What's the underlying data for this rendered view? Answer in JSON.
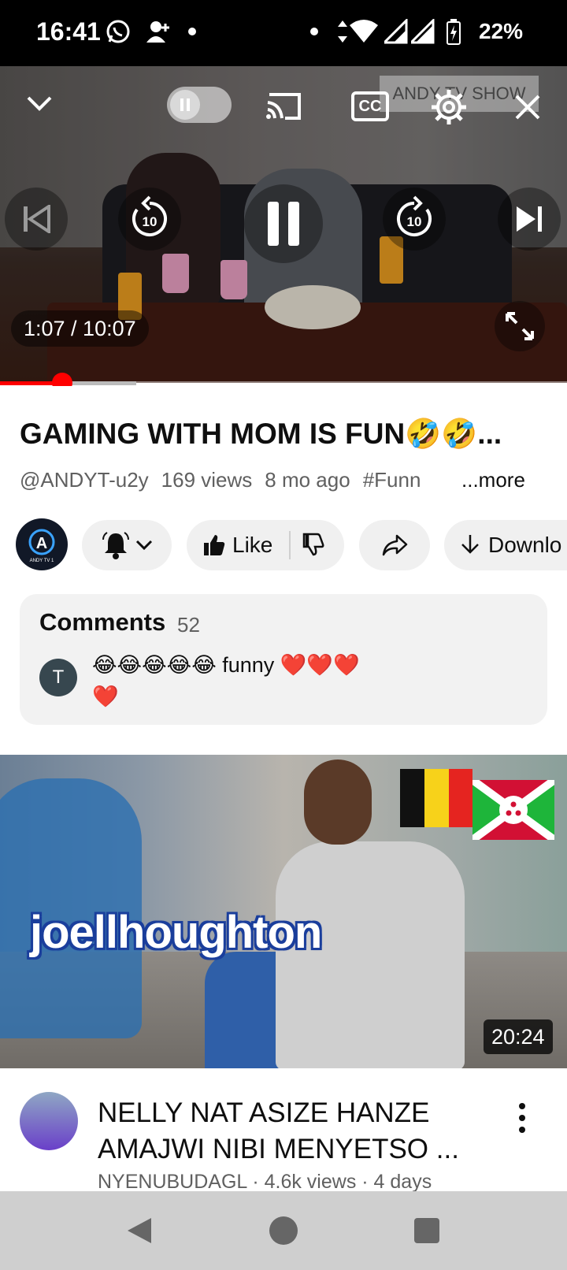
{
  "status_bar": {
    "time": "16:41",
    "battery": "22%",
    "icons": [
      "whatsapp-icon",
      "person-add-icon",
      "dot-icon",
      "dot-icon",
      "data-arrows-icon",
      "wifi-icon",
      "signal-icon",
      "signal-icon",
      "battery-charging-icon"
    ]
  },
  "player": {
    "watermark": "ANDY TV SHOW",
    "time_display": "1:07 / 10:07",
    "progress_played_pct": 11,
    "progress_buffered_pct": 24,
    "seek_back_seconds": "10",
    "seek_forward_seconds": "10",
    "cc_label": "CC",
    "icons": [
      "collapse-chevron-icon",
      "autoplay-toggle-icon",
      "cast-icon",
      "captions-icon",
      "settings-gear-icon",
      "close-icon",
      "previous-icon",
      "replay-10-icon",
      "pause-icon",
      "forward-10-icon",
      "next-icon",
      "fullscreen-icon"
    ]
  },
  "video": {
    "title": "GAMING WITH MOM  IS FUN🤣🤣...",
    "channel": "@ANDYT-u2y",
    "views": "169 views",
    "age": "8 mo ago",
    "hashtag": "#Funn",
    "more": "...more"
  },
  "actions": {
    "avatar_letter": "A",
    "avatar_caption": "ANDY TV 1",
    "like_label": "Like",
    "download_label": "Downlo",
    "icons": [
      "bell-icon",
      "chevron-down-icon",
      "thumbs-up-icon",
      "thumbs-down-icon",
      "share-icon",
      "download-icon"
    ]
  },
  "comments": {
    "title": "Comments",
    "count": "52",
    "top_comment": {
      "avatar_letter": "T",
      "text": "😂😂😂😂😂 funny ❤️❤️❤️ ❤️"
    }
  },
  "next_video": {
    "thumbnail_text": "joellhoughton",
    "duration": "20:24",
    "title": "NELLY NAT ASIZE HANZE AMAJWI NIBI MENYETSO ...",
    "meta": "NYENUBUDAGL · 4.6k views · 4 days"
  },
  "nav_bar": {
    "icons": [
      "back-icon",
      "home-icon",
      "recents-icon"
    ]
  },
  "colors": {
    "accent": "#ff0000",
    "text_primary": "#0f0f0f",
    "text_secondary": "#606060",
    "chip_bg": "#f0f0f0"
  }
}
